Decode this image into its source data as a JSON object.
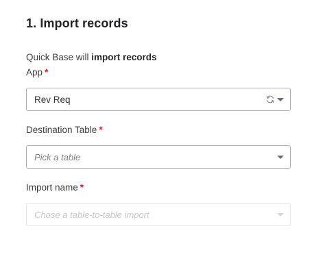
{
  "step": {
    "title": "1. Import records"
  },
  "intro": {
    "prefix": "Quick Base will ",
    "bold": "import records"
  },
  "fields": {
    "app": {
      "label": "App",
      "required_mark": "*",
      "value": "Rev Req"
    },
    "destination_table": {
      "label": "Destination Table",
      "required_mark": "*",
      "placeholder": "Pick a table"
    },
    "import_name": {
      "label": "Import name",
      "required_mark": "*",
      "placeholder": "Chose a table-to-table import"
    }
  },
  "icons": {
    "refresh": "refresh-icon",
    "dropdown": "chevron-down-icon"
  },
  "colors": {
    "required": "#d1202e",
    "border": "#a9adb3",
    "disabled_border": "#e3e5e8"
  }
}
